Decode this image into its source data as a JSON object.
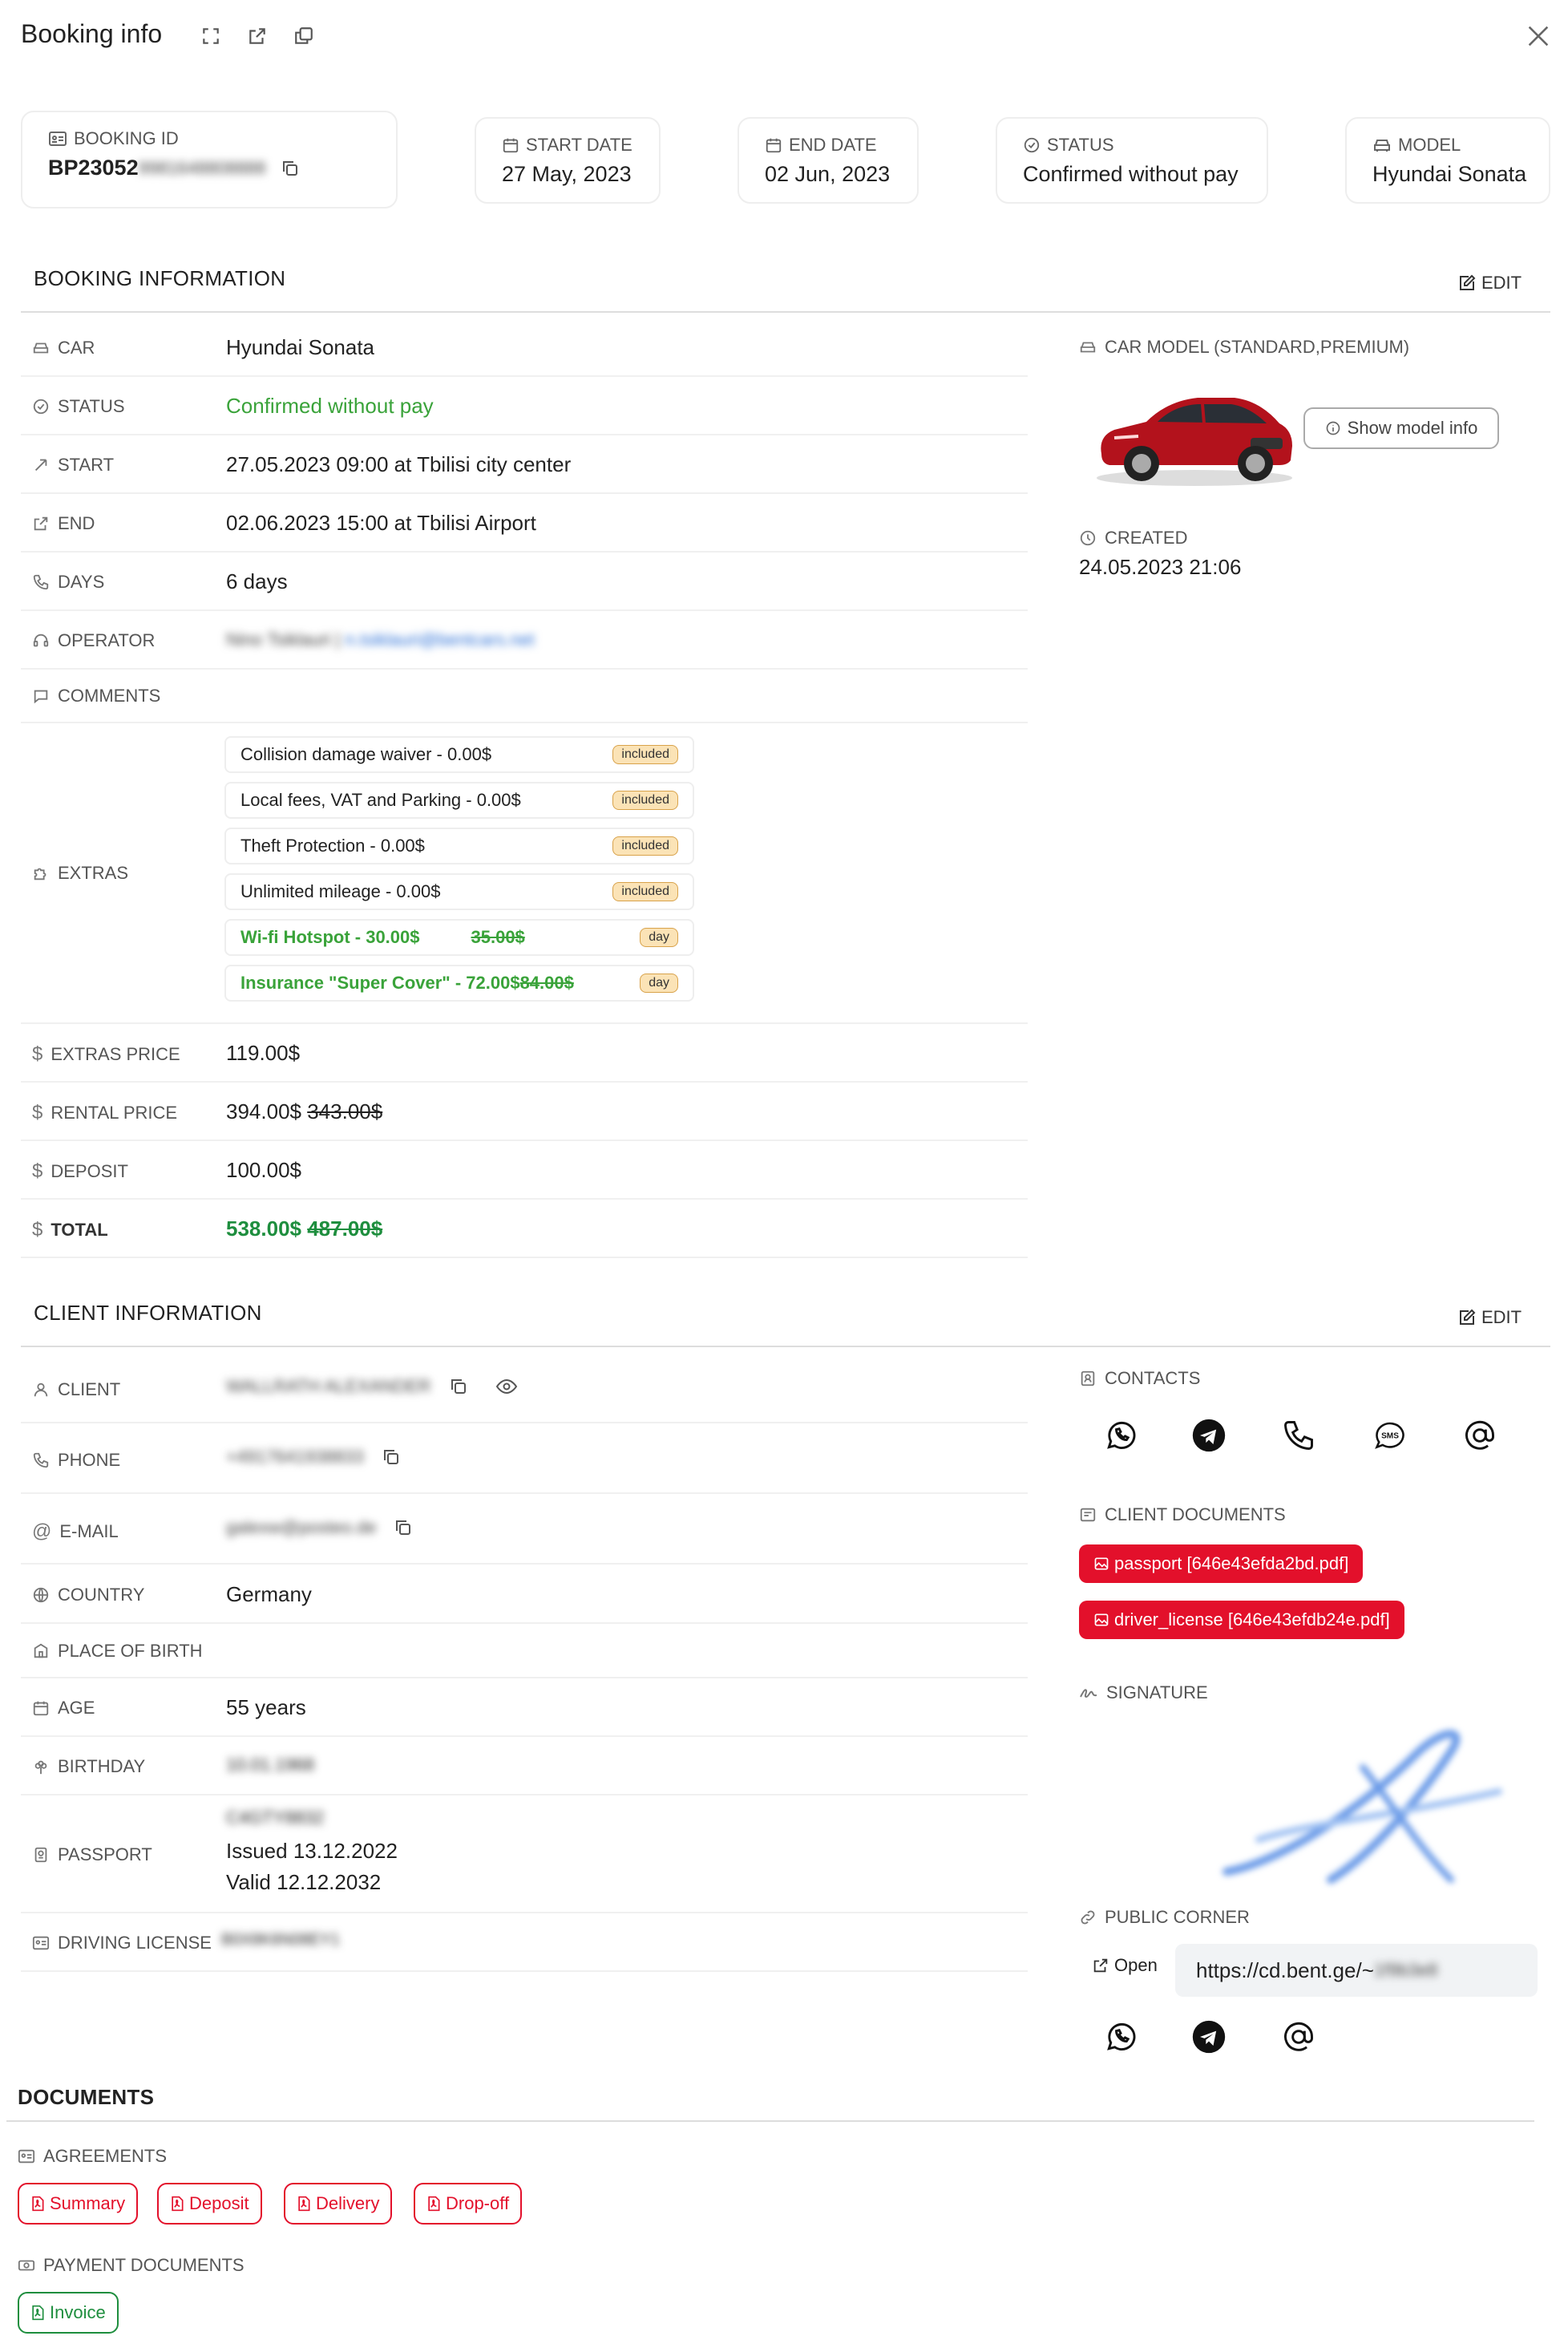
{
  "header": {
    "title": "Booking info",
    "close_label": "×"
  },
  "summary": {
    "booking_id_label": "BOOKING ID",
    "booking_id_value": "BP23052",
    "booking_id_hidden": "9981648808888",
    "start_date_label": "START DATE",
    "start_date_value": "27 May, 2023",
    "end_date_label": "END DATE",
    "end_date_value": "02 Jun, 2023",
    "status_label": "STATUS",
    "status_value": "Confirmed without pay",
    "model_label": "MODEL",
    "model_value": "Hyundai Sonata"
  },
  "booking_info": {
    "title": "BOOKING INFORMATION",
    "edit_label": "EDIT",
    "rows": {
      "car": {
        "label": "CAR",
        "value": "Hyundai Sonata"
      },
      "status": {
        "label": "STATUS",
        "value": "Confirmed without pay"
      },
      "start": {
        "label": "START",
        "value": "27.05.2023 09:00 at Tbilisi city center"
      },
      "end": {
        "label": "END",
        "value": "02.06.2023 15:00 at Tbilisi Airport"
      },
      "days": {
        "label": "DAYS",
        "value": "6 days"
      },
      "operator": {
        "label": "OPERATOR",
        "value_name": "Nino Tsiklauri",
        "value_email": "n.tsiklauri@bentcars.net"
      },
      "comments": {
        "label": "COMMENTS"
      },
      "extras": {
        "label": "EXTRAS"
      },
      "extras_price": {
        "label": "EXTRAS PRICE",
        "value": "119.00$"
      },
      "rental_price": {
        "label": "RENTAL PRICE",
        "value": "394.00$",
        "old": "343.00$"
      },
      "deposit": {
        "label": "DEPOSIT",
        "value": "100.00$"
      },
      "total": {
        "label": "TOTAL",
        "value": "538.00$",
        "old": "487.00$"
      }
    },
    "extras": [
      {
        "name": "Collision damage waiver - 0.00$",
        "badge": "included"
      },
      {
        "name": "Local fees, VAT and Parking - 0.00$",
        "badge": "included"
      },
      {
        "name": "Theft Protection - 0.00$",
        "badge": "included"
      },
      {
        "name": "Unlimited mileage - 0.00$",
        "badge": "included"
      },
      {
        "name": "Wi-fi Hotspot - 30.00$",
        "old": "35.00$",
        "badge": "day"
      },
      {
        "name": "Insurance \"Super Cover\" - 72.00$",
        "old": "84.00$",
        "badge": "day"
      }
    ],
    "car_model_label": "CAR MODEL (STANDARD,PREMIUM)",
    "show_model_info": "Show model info",
    "created_label": "CREATED",
    "created_value": "24.05.2023 21:06"
  },
  "client_info": {
    "title": "CLIENT INFORMATION",
    "edit_label": "EDIT",
    "rows": {
      "client": {
        "label": "CLIENT",
        "value": "WALLRATH ALEXANDER"
      },
      "phone": {
        "label": "PHONE",
        "value": "+4917641938833"
      },
      "email": {
        "label": "E-MAIL",
        "value": "galexw@posteo.de"
      },
      "country": {
        "label": "COUNTRY",
        "value": "Germany"
      },
      "place_of_birth": {
        "label": "PLACE OF BIRTH"
      },
      "age": {
        "label": "AGE",
        "value": "55 years"
      },
      "birthday": {
        "label": "BIRTHDAY",
        "value": "10.01.1968"
      },
      "passport": {
        "label": "PASSPORT",
        "number": "C4GTY8832",
        "issued": "Issued 13.12.2022",
        "valid": "Valid 12.12.2032"
      },
      "driving_license": {
        "label": "DRIVING LICENSE",
        "value": "B0X8K6N08EY1"
      }
    },
    "contacts_label": "CONTACTS",
    "client_documents_label": "CLIENT DOCUMENTS",
    "documents": [
      "passport [646e43efda2bd.pdf]",
      "driver_license [646e43efdb24e.pdf]"
    ],
    "signature_label": "SIGNATURE",
    "public_corner_label": "PUBLIC CORNER",
    "open_label": "Open",
    "public_url": "https://cd.bent.ge/~",
    "public_url_hidden": "1f9b3e8"
  },
  "documents_section": {
    "title": "DOCUMENTS",
    "agreements_label": "AGREEMENTS",
    "agreements": [
      "Summary",
      "Deposit",
      "Delivery",
      "Drop-off"
    ],
    "payment_label": "PAYMENT DOCUMENTS",
    "payment": [
      "Invoice"
    ]
  },
  "colors": {
    "accent_red": "#e3102b",
    "green": "#3aa33a",
    "dark_green": "#1e8e3e",
    "badge_bg": "#fbe3b6"
  }
}
